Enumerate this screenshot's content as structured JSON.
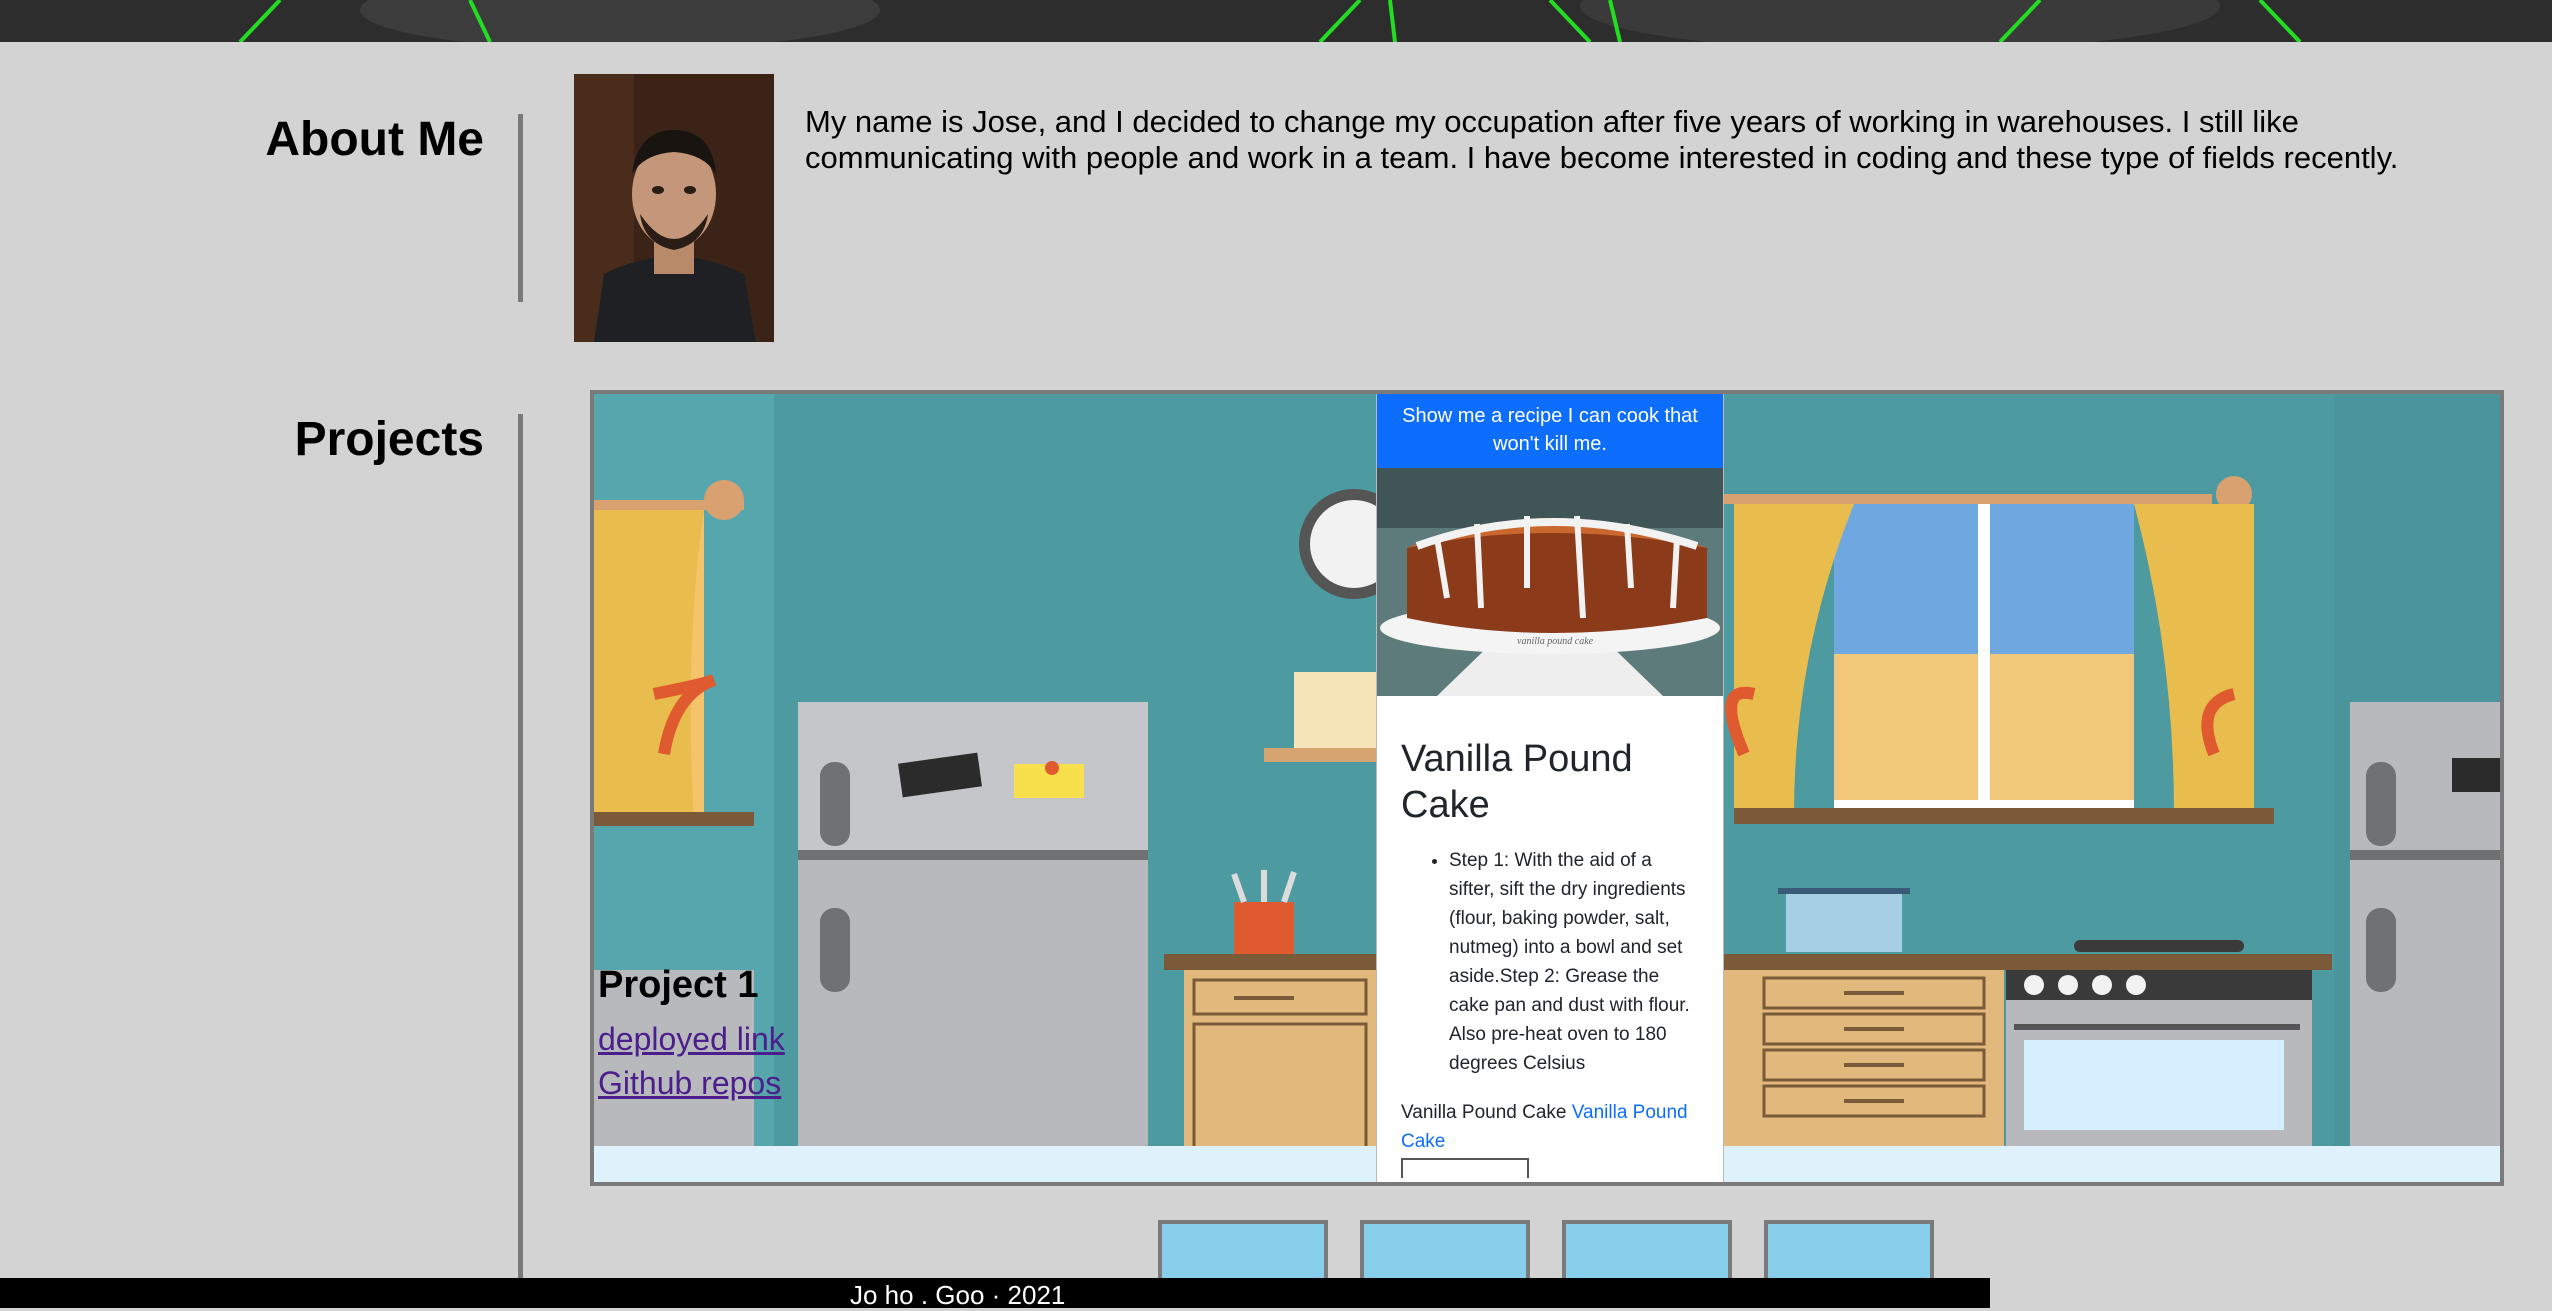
{
  "about": {
    "heading": "About Me",
    "bio": "My name is Jose, and I decided to change my occupation after five years of working in warehouses. I still like communicating with people and work in a team. I have become interested in coding and these type of fields recently."
  },
  "projects": {
    "heading": "Projects",
    "items": [
      {
        "title": "Project 1",
        "deployed_label": "deployed link",
        "repo_label": "Github repos"
      }
    ]
  },
  "recipe_app": {
    "button_label": "Show me a recipe I can cook that won't kill me.",
    "image_caption": "vanilla pound cake",
    "recipe_title": "Vanilla Pound Cake",
    "steps": [
      "Step 1: With the aid of a sifter, sift the dry ingredients (flour, baking powder, salt, nutmeg) into a bowl and set aside.Step 2: Grease the cake pan and dust with flour. Also pre-heat oven to 180 degrees Celsius"
    ],
    "source_text": "Vanilla Pound Cake",
    "source_link": "Vanilla Pound Cake"
  },
  "footer": {
    "text": "Jo  ho  . Goo  ·  2021"
  },
  "colors": {
    "page_bg": "#d3d3d3",
    "kitchen_wall": "#56a6ad",
    "button_blue": "#0d6efd",
    "link_purple": "#4b1e8c",
    "hero_green": "#22dd22"
  }
}
